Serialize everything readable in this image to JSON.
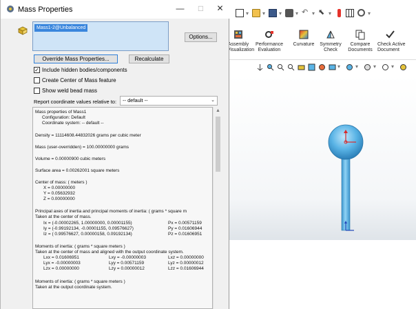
{
  "dialog": {
    "title": "Mass Properties",
    "minimize_glyph": "—",
    "maximize_glyph": "□",
    "close_glyph": "✕",
    "selection_item": "Mass1-2@Unbalanced",
    "options_label": "Options...",
    "override_label": "Override Mass Properties...",
    "recalculate_label": "Recalculate",
    "include_hidden_label": "Include hidden bodies/components",
    "include_hidden_checked": true,
    "create_com_label": "Create Center of Mass feature",
    "create_com_checked": false,
    "show_weld_label": "Show weld bead mass",
    "show_weld_checked": false,
    "coord_label": "Report coordinate values relative to:",
    "coord_value": "-- default --",
    "check_glyph": "✓"
  },
  "results": {
    "header": "Mass properties of Mass1",
    "configuration": "Configuration: Default",
    "coordinate_system": "Coordinate system: -- default --",
    "density": "Density = 11114608.44832026 grams per cubic meter",
    "mass": "Mass (user-overridden) = 100.00000000 grams",
    "volume": "Volume = 0.00000900 cubic meters",
    "surface_area": "Surface area = 0.00262001 square meters",
    "com_header": "Center of mass: ( meters )",
    "com_x": "X = 0.00000000",
    "com_y": "Y = 0.05632932",
    "com_z": "Z = 0.00000000",
    "principal_header": "Principal axes of inertia and principal moments of inertia: ( grams * square m",
    "principal_sub": "Taken at the center of mass.",
    "ix": "Ix = (-0.00002265,  1.00000000,  0.00001155)",
    "iy": "Iy = (-0.99192134, -0.00001155,  0.09576627)",
    "iz": "Iz = ( 0.99576627,  0.00000158,  0.09192134)",
    "px": "Px = 0.00571159",
    "py": "Py = 0.01606944",
    "pz": "Pz = 0.01606951",
    "moi_header": "Moments of inertia: ( grams * square meters )",
    "moi_sub": "Taken at the center of mass and aligned with the output coordinate system.",
    "lxx": "Lxx = 0.01606951",
    "lxy": "Lxy = -0.00000003",
    "lxz": "Lxz = 0.00000000",
    "lyx": "Lyx = -0.00000003",
    "lyy": "Lyy = 0.00571159",
    "lyz": "Lyz = 0.00000012",
    "lzx": "Lzx = 0.00000000",
    "lzy": "Lzy = 0.00000012",
    "lzz": "Lzz = 0.01606944",
    "moi2_header": "Moments of inertia: ( grams * square meters )",
    "moi2_sub": "Taken at the output coordinate system."
  },
  "ribbon": {
    "assembly_visualization": [
      "Assembly",
      "Visualization"
    ],
    "performance_evaluation": [
      "Performance",
      "Evaluation"
    ],
    "curvature": [
      "Curvature"
    ],
    "symmetry_check": [
      "Symmetry",
      "Check"
    ],
    "compare_documents": [
      "Compare",
      "Documents"
    ],
    "check_active": [
      "Check Active",
      "Document"
    ]
  },
  "colors": {
    "accent_blue": "#3a86dd",
    "model_blue": "#5ab4e6",
    "selection_bg": "#cfe4f7"
  }
}
